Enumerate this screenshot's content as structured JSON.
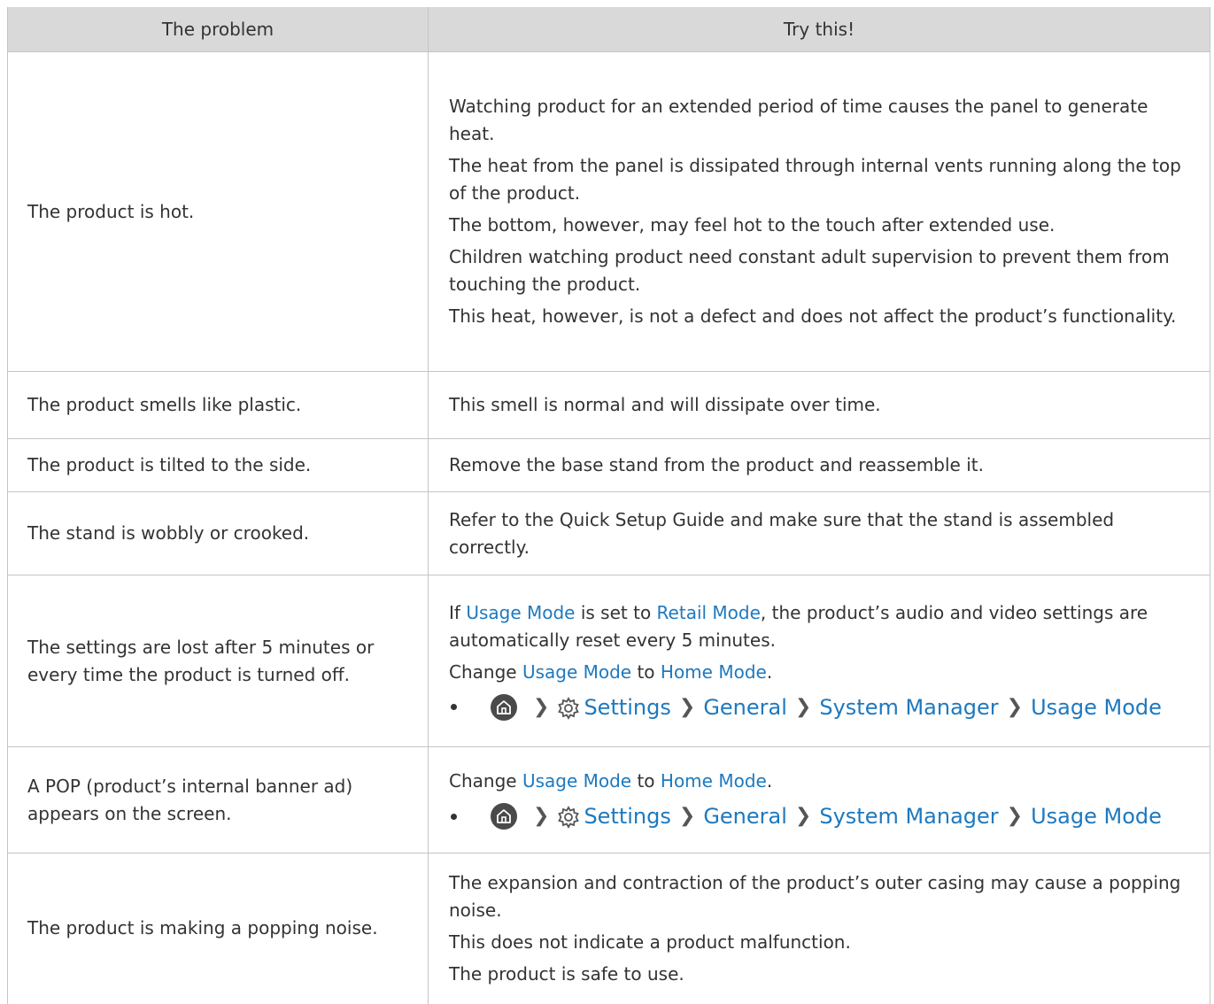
{
  "header": {
    "problem": "The problem",
    "try": "Try this!"
  },
  "rows": [
    {
      "problem": "The product is hot.",
      "fixes": [
        "Watching product for an extended period of time causes the panel to generate heat.",
        "The heat from the panel is dissipated through internal vents running along the top of the product.",
        "The bottom, however, may feel hot to the touch after extended use.",
        "Children watching product need constant adult supervision to prevent them from touching the product.",
        "This heat, however, is not a defect and does not affect the product’s functionality."
      ]
    },
    {
      "problem": "The product smells like plastic.",
      "fixes": [
        "This smell is normal and will dissipate over time."
      ]
    },
    {
      "problem": "The product is tilted to the side.",
      "fixes": [
        "Remove the base stand from the product and reassemble it."
      ]
    },
    {
      "problem": "The stand is wobbly or crooked.",
      "fixes": [
        "Refer to the Quick Setup Guide and make sure that the stand is assembled correctly."
      ]
    },
    {
      "problem": "The settings are lost after 5 minutes or every time the product is turned off.",
      "fix_a": {
        "if": "If",
        "usage_mode": "Usage Mode",
        "is_set_to": "is set to",
        "retail_mode": "Retail Mode",
        "rest": ", the product’s audio and video settings are automatically reset every 5 minutes."
      },
      "fix_b": {
        "change": "Change",
        "usage_mode": "Usage Mode",
        "to": "to",
        "home_mode": "Home Mode",
        "period": "."
      }
    },
    {
      "problem": "A POP (product’s internal banner ad) appears on the screen.",
      "fix_b": {
        "change": "Change",
        "usage_mode": "Usage Mode",
        "to": "to",
        "home_mode": "Home Mode",
        "period": "."
      }
    },
    {
      "problem": "The product is making a popping noise.",
      "fixes": [
        "The expansion and contraction of the product’s outer casing may cause a popping noise.",
        "This does not indicate a product malfunction.",
        "The product is safe to use."
      ]
    }
  ],
  "menu_path": {
    "home_icon": "home-icon",
    "gear_icon": "gear-icon",
    "chevron": "❯",
    "settings": "Settings",
    "general": "General",
    "system_manager": "System Manager",
    "usage_mode": "Usage Mode"
  },
  "colors": {
    "header_bg": "#d9d9d9",
    "border": "#c4c4c4",
    "link": "#1d79bf",
    "text": "#333333"
  }
}
